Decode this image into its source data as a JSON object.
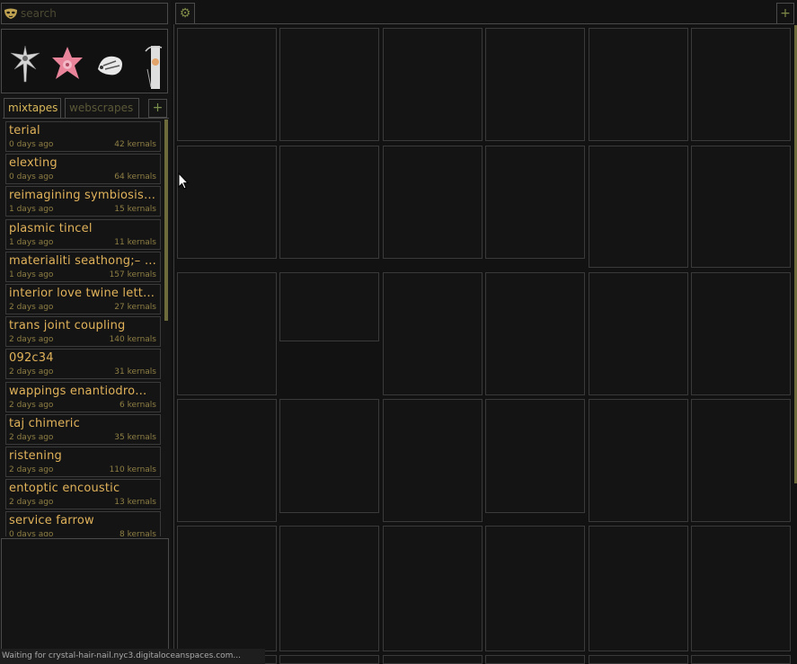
{
  "search": {
    "placeholder": "search",
    "value": ""
  },
  "sidebar": {
    "tabs": [
      {
        "label": "mixtapes",
        "active": true
      },
      {
        "label": "webscrapes",
        "active": false
      }
    ],
    "add_tab_label": "+",
    "mixtapes": [
      {
        "title": "terial",
        "age": "0 days ago",
        "count": "42 kernals"
      },
      {
        "title": "elexting",
        "age": "0 days ago",
        "count": "64 kernals"
      },
      {
        "title": "reimagining symbiosis a…",
        "age": "1 days ago",
        "count": "15 kernals"
      },
      {
        "title": "plasmic tincel",
        "age": "1 days ago",
        "count": "11 kernals"
      },
      {
        "title": "materialiti seathong;– k…",
        "age": "1 days ago",
        "count": "157 kernals"
      },
      {
        "title": "interior love twine lette…",
        "age": "2 days ago",
        "count": "27 kernals"
      },
      {
        "title": "trans joint coupling",
        "age": "2 days ago",
        "count": "140 kernals"
      },
      {
        "title": "092c34",
        "age": "2 days ago",
        "count": "31 kernals"
      },
      {
        "title": "wappings enantiodromol…",
        "age": "2 days ago",
        "count": "6 kernals"
      },
      {
        "title": "taj chimeric",
        "age": "2 days ago",
        "count": "35 kernals"
      },
      {
        "title": "ristening",
        "age": "2 days ago",
        "count": "110 kernals"
      },
      {
        "title": "entoptic encoustic",
        "age": "2 days ago",
        "count": "13 kernals"
      },
      {
        "title": "service farrow",
        "age": "0 days ago",
        "count": "8 kernals"
      }
    ]
  },
  "toolbar": {
    "gear_label": "⚙",
    "add_label": "+"
  },
  "status": "Waiting for crystal-hair-nail.nyc3.digitaloceanspaces.com...",
  "colors": {
    "accent": "#d9b85a",
    "muted": "#8f7f44",
    "border": "#4a4a4a",
    "background": "#121212"
  },
  "icons": [
    "mask-icon",
    "gear-icon",
    "plus-icon",
    "cursor-icon"
  ]
}
